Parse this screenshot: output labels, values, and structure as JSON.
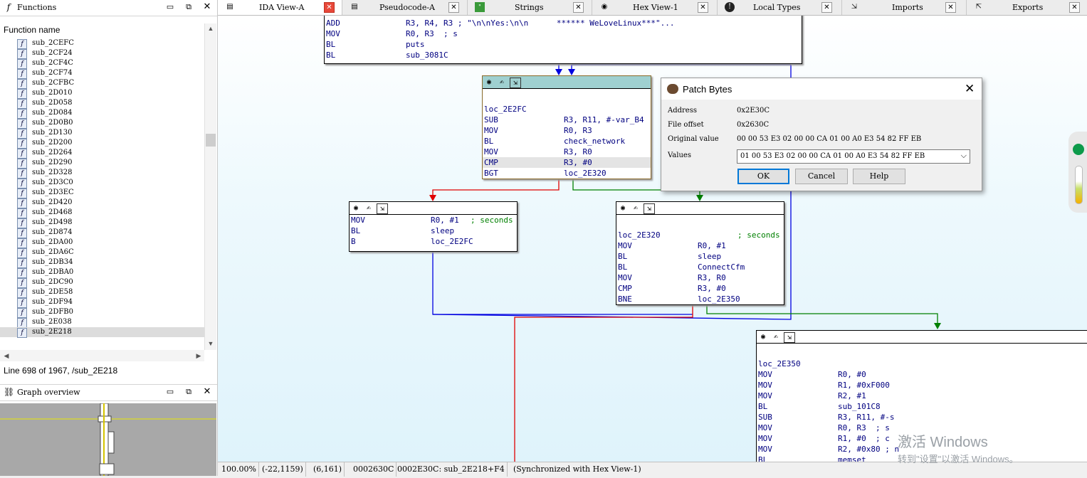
{
  "functions_panel": {
    "title": "Functions",
    "column_header": "Function name",
    "items": [
      "sub_2CEFC",
      "sub_2CF24",
      "sub_2CF4C",
      "sub_2CF74",
      "sub_2CFBC",
      "sub_2D010",
      "sub_2D058",
      "sub_2D084",
      "sub_2D0B0",
      "sub_2D130",
      "sub_2D200",
      "sub_2D264",
      "sub_2D290",
      "sub_2D328",
      "sub_2D3C0",
      "sub_2D3EC",
      "sub_2D420",
      "sub_2D468",
      "sub_2D498",
      "sub_2D874",
      "sub_2DA00",
      "sub_2DA6C",
      "sub_2DB34",
      "sub_2DBA0",
      "sub_2DC90",
      "sub_2DE58",
      "sub_2DF94",
      "sub_2DFB0",
      "sub_2E038",
      "sub_2E218"
    ],
    "selected": "sub_2E218",
    "line_info": "Line 698 of 1967, /sub_2E218"
  },
  "graph_overview": {
    "title": "Graph overview"
  },
  "tabs": [
    {
      "label": "IDA View-A",
      "active": true
    },
    {
      "label": "Pseudocode-A"
    },
    {
      "label": "Strings"
    },
    {
      "label": "Hex View-1"
    },
    {
      "label": "Local Types"
    },
    {
      "label": "Imports"
    },
    {
      "label": "Exports"
    }
  ],
  "nodes": {
    "top": {
      "lines": [
        {
          "m": "ADD",
          "o": "R3, R4, R3 ; \"\\n\\nYes:\\n\\n      ****** WeLoveLinux***\"..."
        },
        {
          "m": "MOV",
          "o": "R0, R3  ; s"
        },
        {
          "m": "BL",
          "o": "puts"
        },
        {
          "m": "BL",
          "o": "sub_3081C"
        }
      ]
    },
    "loc_2E2FC": {
      "label": "loc_2E2FC",
      "lines": [
        {
          "m": "SUB",
          "o": "R3, R11, #-var_B4"
        },
        {
          "m": "MOV",
          "o": "R0, R3"
        },
        {
          "m": "BL",
          "o": "check_network"
        },
        {
          "m": "MOV",
          "o": "R3, R0"
        },
        {
          "m": "CMP",
          "o": "R3, #0"
        },
        {
          "m": "BGT",
          "o": "loc_2E320"
        }
      ]
    },
    "sleep_block": {
      "lines": [
        {
          "m": "MOV",
          "o": "R0, #1",
          "c": "; seconds"
        },
        {
          "m": "BL",
          "o": "sleep"
        },
        {
          "m": "B",
          "o": "loc_2E2FC"
        }
      ]
    },
    "loc_2E320": {
      "label": "loc_2E320",
      "comment": "; seconds",
      "lines": [
        {
          "m": "MOV",
          "o": "R0, #1"
        },
        {
          "m": "BL",
          "o": "sleep"
        },
        {
          "m": "BL",
          "o": "ConnectCfm"
        },
        {
          "m": "MOV",
          "o": "R3, R0"
        },
        {
          "m": "CMP",
          "o": "R3, #0"
        },
        {
          "m": "BNE",
          "o": "loc_2E350"
        }
      ]
    },
    "loc_2E350": {
      "label": "loc_2E350",
      "lines": [
        {
          "m": "MOV",
          "o": "R0, #0"
        },
        {
          "m": "MOV",
          "o": "R1, #0xF000"
        },
        {
          "m": "MOV",
          "o": "R2, #1"
        },
        {
          "m": "BL",
          "o": "sub_101C8"
        },
        {
          "m": "SUB",
          "o": "R3, R11, #-s"
        },
        {
          "m": "MOV",
          "o": "R0, R3  ; s"
        },
        {
          "m": "MOV",
          "o": "R1, #0  ; c"
        },
        {
          "m": "MOV",
          "o": "R2, #0x80 ; n"
        },
        {
          "m": "BL",
          "o": "memset"
        }
      ]
    }
  },
  "patch_dialog": {
    "title": "Patch Bytes",
    "address_label": "Address",
    "address": "0x2E30C",
    "file_offset_label": "File offset",
    "file_offset": "0x2630C",
    "original_label": "Original value",
    "original": "00 00 53 E3 02 00 00 CA 01 00 A0 E3 54 82 FF EB",
    "values_label": "Values",
    "values": "01 00 53 E3 02 00 00 CA 01 00 A0 E3 54 82 FF EB",
    "ok": "OK",
    "cancel": "Cancel",
    "help": "Help"
  },
  "status_bar": [
    "100.00%",
    "(-22,1159)",
    "(6,161)",
    "0002630C",
    "0002E30C: sub_2E218+F4",
    "(Synchronized with Hex View-1)"
  ],
  "watermark": {
    "line1": "激活 Windows",
    "line2": "转到\"设置\"以激活 Windows。"
  },
  "colors": {
    "edge_true": "#008000",
    "edge_false": "#e00000",
    "edge_jump": "#0000e0",
    "selected_header": "#9fd0d0"
  }
}
